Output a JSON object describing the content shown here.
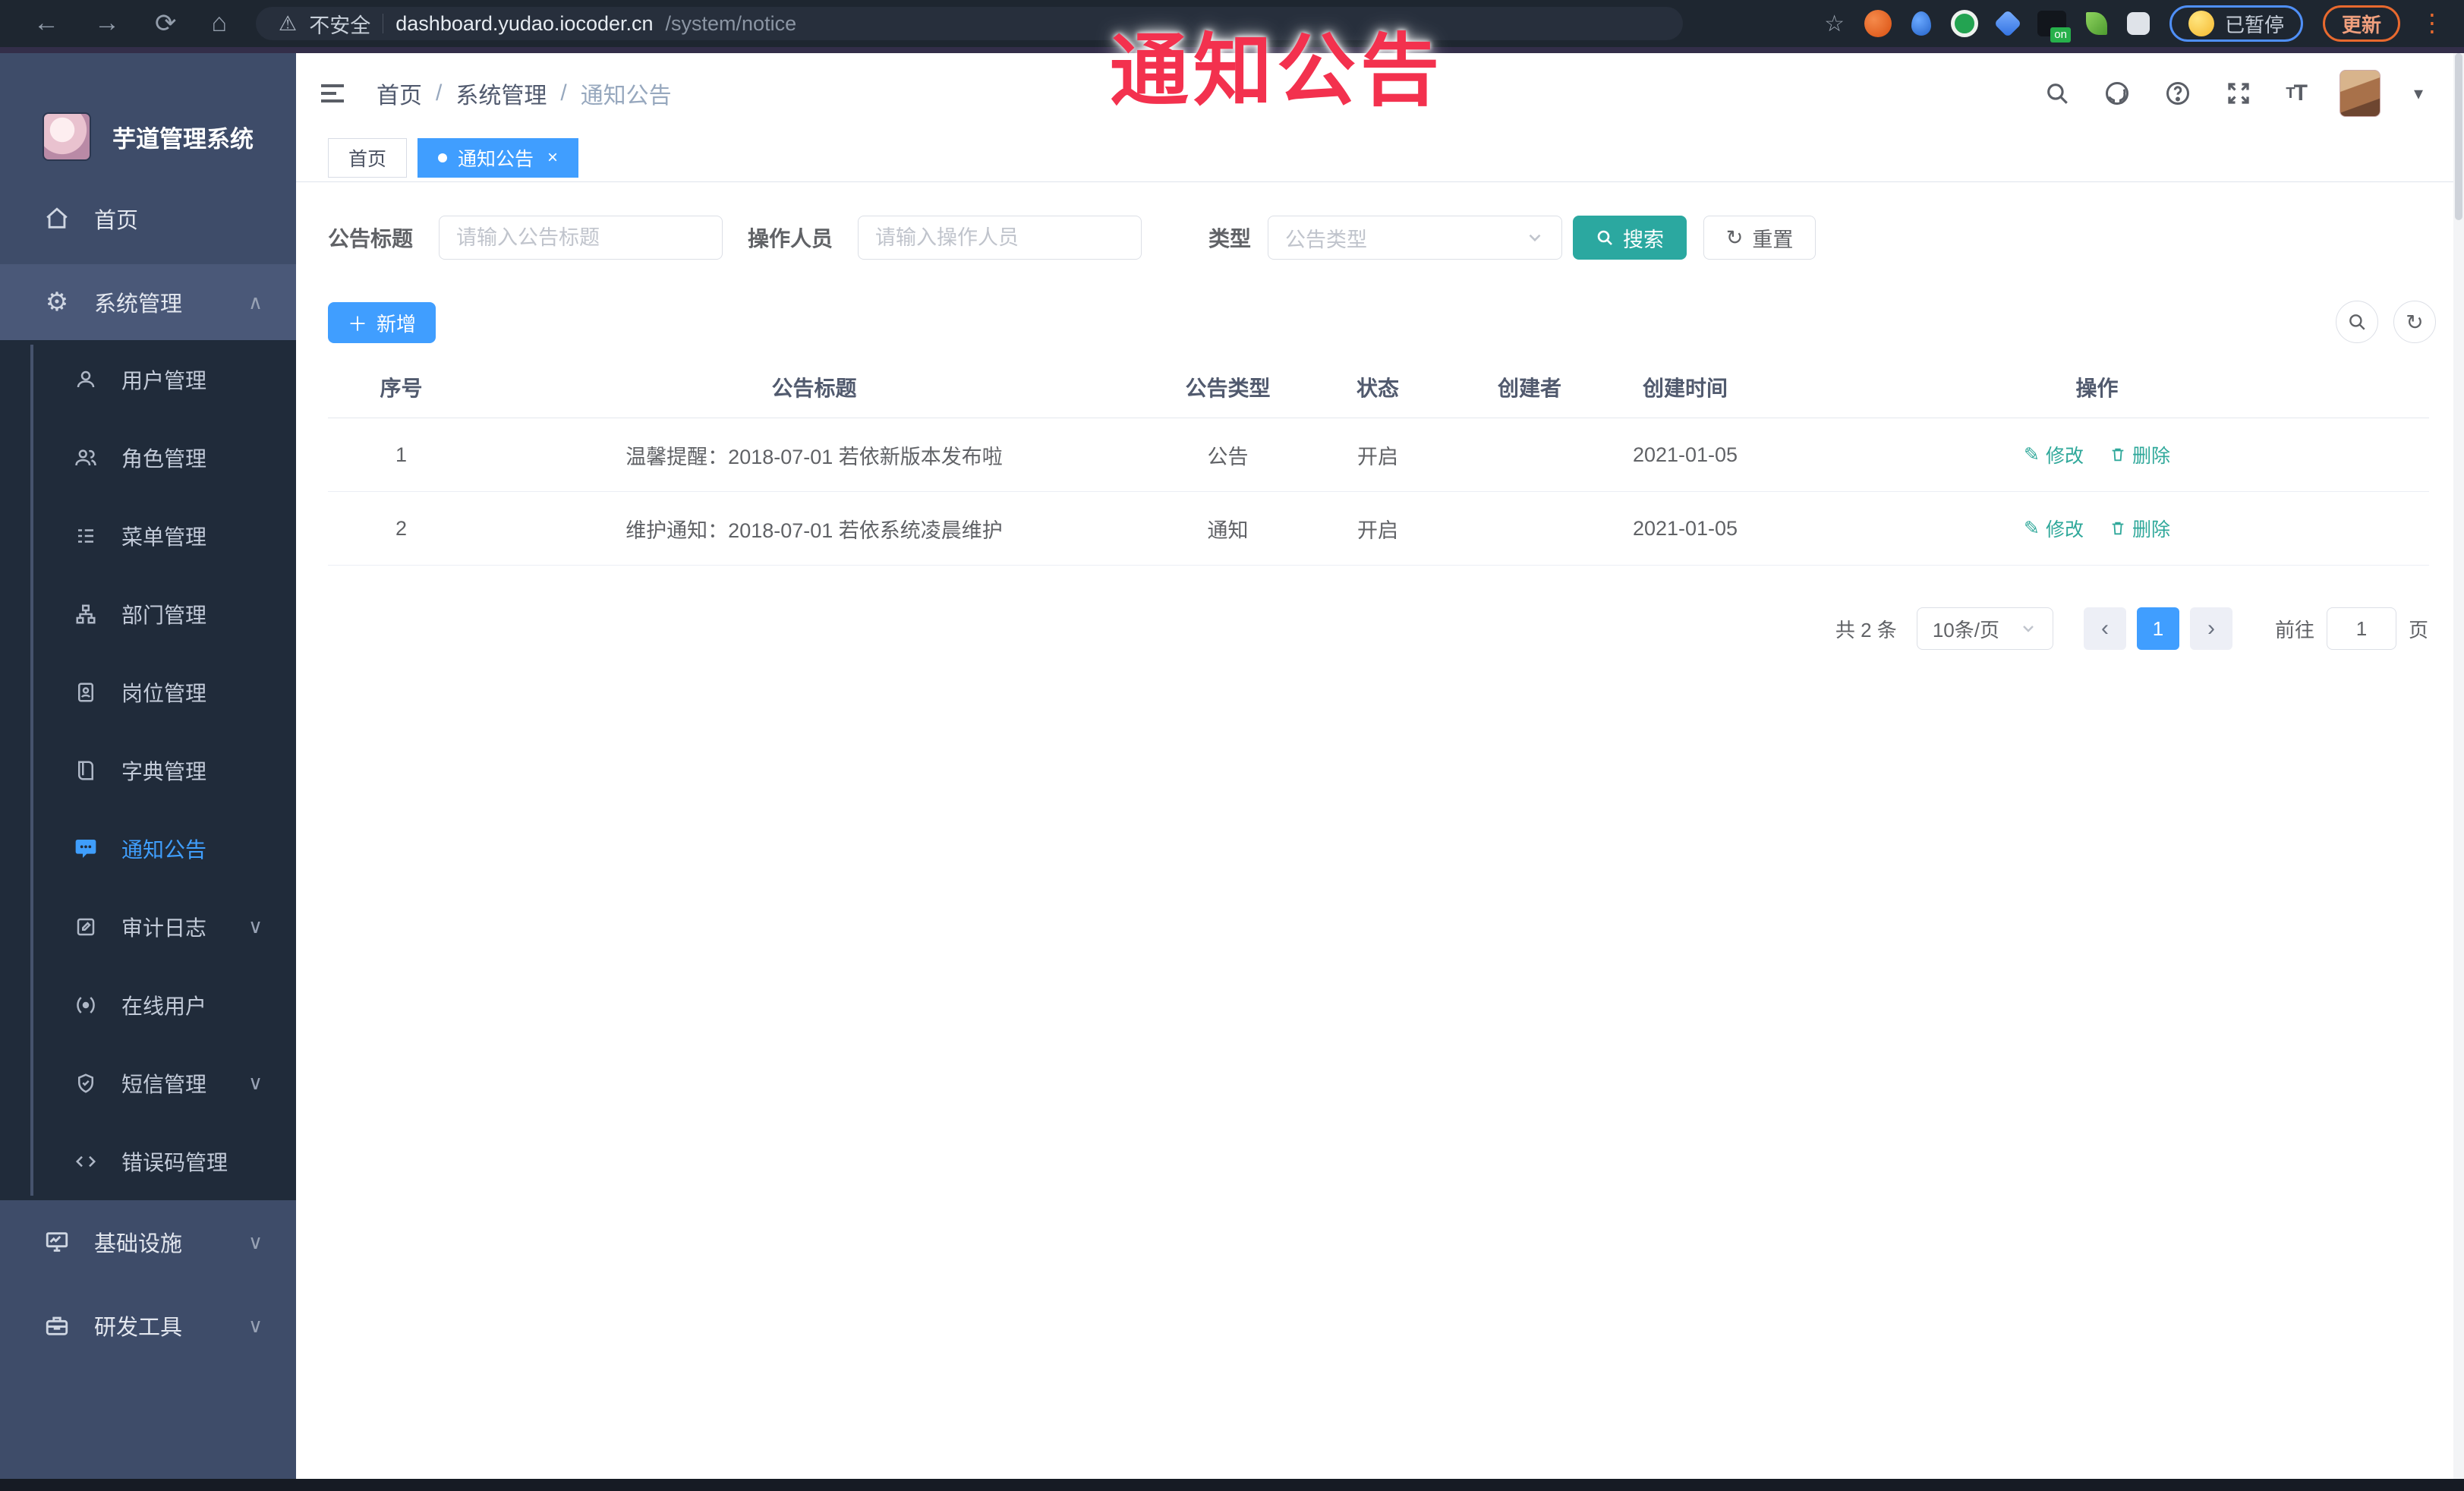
{
  "browser": {
    "security_label": "不安全",
    "url_host": "dashboard.yudao.iocoder.cn",
    "url_path": "/system/notice",
    "on_badge": "on",
    "paused_badge": "已暂停",
    "update_button": "更新"
  },
  "watermark": {
    "text": "通知公告",
    "color": "#f3314e"
  },
  "sidebar": {
    "logo_title": "芋道管理系统",
    "home": {
      "label": "首页"
    },
    "system": {
      "label": "系统管理"
    },
    "submenu": [
      {
        "label": "用户管理"
      },
      {
        "label": "角色管理"
      },
      {
        "label": "菜单管理"
      },
      {
        "label": "部门管理"
      },
      {
        "label": "岗位管理"
      },
      {
        "label": "字典管理"
      },
      {
        "label": "通知公告"
      },
      {
        "label": "审计日志"
      },
      {
        "label": "在线用户"
      },
      {
        "label": "短信管理"
      },
      {
        "label": "错误码管理"
      }
    ],
    "bottom": [
      {
        "label": "基础设施"
      },
      {
        "label": "研发工具"
      }
    ]
  },
  "header": {
    "breadcrumb": {
      "home": "首页",
      "section": "系统管理",
      "current": "通知公告",
      "separator": "/"
    }
  },
  "tabs": {
    "home": "首页",
    "current": "通知公告",
    "close_icon": "×"
  },
  "filters": {
    "title_label": "公告标题",
    "title_placeholder": "请输入公告标题",
    "operator_label": "操作人员",
    "operator_placeholder": "请输入操作人员",
    "type_label": "类型",
    "type_placeholder": "公告类型",
    "search_label": "搜索",
    "reset_label": "重置"
  },
  "toolbar": {
    "add_label": "新增"
  },
  "table": {
    "columns": {
      "no": "序号",
      "title": "公告标题",
      "type": "公告类型",
      "status": "状态",
      "creator": "创建者",
      "created": "创建时间",
      "actions": "操作"
    },
    "rows": [
      {
        "no": "1",
        "title": "温馨提醒：2018-07-01 若依新版本发布啦",
        "type": "公告",
        "status": "开启",
        "creator": "",
        "created": "2021-01-05"
      },
      {
        "no": "2",
        "title": "维护通知：2018-07-01 若依系统凌晨维护",
        "type": "通知",
        "status": "开启",
        "creator": "",
        "created": "2021-01-05"
      }
    ],
    "actions": {
      "edit": "修改",
      "delete": "删除"
    }
  },
  "pagination": {
    "total": "共 2 条",
    "page_size": "10条/页",
    "prev": "‹",
    "page": "1",
    "next": "›",
    "goto_label": "前往",
    "goto_value": "1",
    "unit": "页"
  },
  "colors": {
    "primary": "#409eff",
    "search_teal": "#2ba8a0",
    "action_teal": "#2fa89a",
    "watermark_red": "#f3314e"
  }
}
